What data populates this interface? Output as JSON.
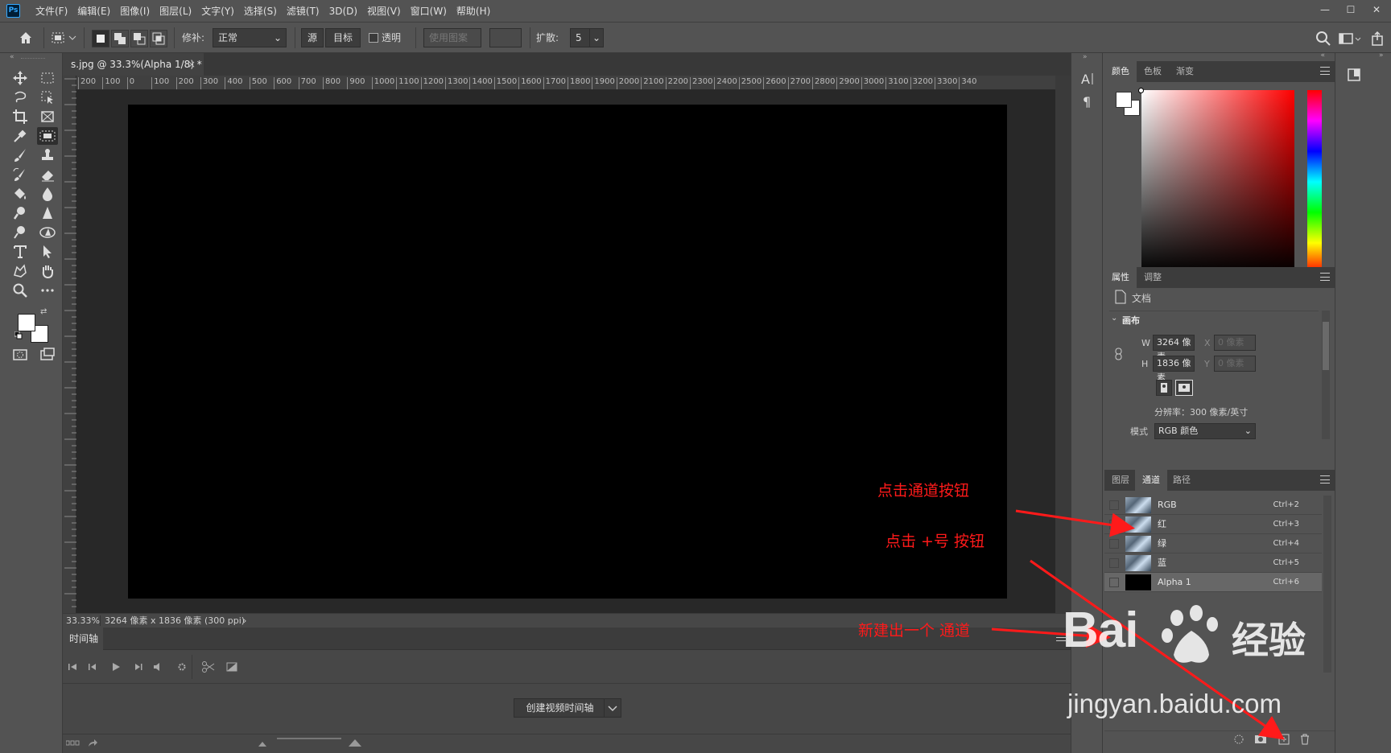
{
  "app": {
    "logo": "Ps"
  },
  "menu": [
    "文件(F)",
    "编辑(E)",
    "图像(I)",
    "图层(L)",
    "文字(Y)",
    "选择(S)",
    "滤镜(T)",
    "3D(D)",
    "视图(V)",
    "窗口(W)",
    "帮助(H)"
  ],
  "window_controls": {
    "minimize": "—",
    "maximize": "☐",
    "close": "✕"
  },
  "options": {
    "patch_label": "修补:",
    "patch_value": "正常",
    "source_label": "源",
    "target_label": "目标",
    "transparent_label": "透明",
    "use_pattern_label": "使用图案",
    "diffusion_label": "扩散:",
    "diffusion_value": "5"
  },
  "document": {
    "tab_title": "s.jpg @ 33.3%(Alpha 1/8) *",
    "close_glyph": "×",
    "ruler_h": [
      "200",
      "100",
      "0",
      "100",
      "200",
      "300",
      "400",
      "500",
      "600",
      "700",
      "800",
      "900",
      "1000",
      "1100",
      "1200",
      "1300",
      "1400",
      "1500",
      "1600",
      "1700",
      "1800",
      "1900",
      "2000",
      "2100",
      "2200",
      "2300",
      "2400",
      "2500",
      "2600",
      "2700",
      "2800",
      "2900",
      "3000",
      "3100",
      "3200",
      "3300",
      "340"
    ],
    "zoom": "33.33%",
    "doc_info": "3264 像素 x 1836 像素 (300 ppi)",
    "status_arrow": "›"
  },
  "timeline": {
    "tab": "时间轴",
    "create_button": "创建视频时间轴"
  },
  "color_panel": {
    "tabs": [
      "颜色",
      "色板",
      "渐变"
    ],
    "foreground": "#ffffff",
    "background": "#ffffff"
  },
  "properties_panel": {
    "tabs": [
      "属性",
      "调整"
    ],
    "doc_label": "文档",
    "section": "画布",
    "w_label": "W",
    "w_value": "3264 像素",
    "h_label": "H",
    "h_value": "1836 像素",
    "x_label": "X",
    "x_value": "0 像素",
    "y_label": "Y",
    "y_value": "0 像素",
    "resolution": "分辨率：300 像素/英寸",
    "mode_label": "模式",
    "mode_value": "RGB 颜色"
  },
  "channels_panel": {
    "tabs": [
      "图层",
      "通道",
      "路径"
    ],
    "rows": [
      {
        "name": "RGB",
        "shortcut": "Ctrl+2"
      },
      {
        "name": "红",
        "shortcut": "Ctrl+3"
      },
      {
        "name": "绿",
        "shortcut": "Ctrl+4"
      },
      {
        "name": "蓝",
        "shortcut": "Ctrl+5"
      },
      {
        "name": "Alpha 1",
        "shortcut": "Ctrl+6"
      }
    ]
  },
  "annotations": {
    "a1": "点击通道按钮",
    "a2": "点击 +号 按钮",
    "a3": "新建出一个 通道"
  },
  "watermark": {
    "brand": "Bai",
    "brand2": "经验",
    "url": "jingyan.baidu.com"
  },
  "colors": {
    "accent_red": "#ff1a1a",
    "panel_bg": "#535353",
    "canvas": "#000000"
  }
}
